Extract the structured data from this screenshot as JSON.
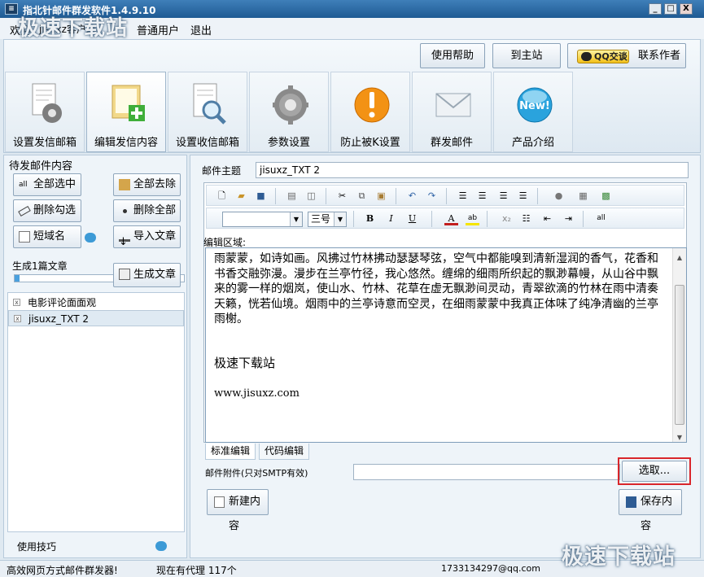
{
  "window": {
    "title": "指北针邮件群发软件1.4.9.10",
    "min_label": "_",
    "max_label": "□",
    "close_label": "X"
  },
  "menu": {
    "welcome": "欢迎",
    "user_text": "jisuxz客户端",
    "role": "普通用户",
    "logout": "退出"
  },
  "watermark_top": "极速下载站",
  "watermark_bottom": "极速下载站",
  "top_buttons": {
    "help": "使用帮助",
    "home": "到主站",
    "qq_badge": "QQ交谈",
    "contact": "联系作者"
  },
  "toolbar": [
    {
      "label": "设置发信邮箱",
      "icon": "gear-document-icon"
    },
    {
      "label": "编辑发信内容",
      "icon": "folder-add-icon"
    },
    {
      "label": "设置收信邮箱",
      "icon": "magnifier-document-icon"
    },
    {
      "label": "参数设置",
      "icon": "gear-icon"
    },
    {
      "label": "防止被K设置",
      "icon": "warning-icon"
    },
    {
      "label": "群发邮件",
      "icon": "envelope-icon"
    },
    {
      "label": "产品介绍",
      "icon": "new-badge-icon"
    }
  ],
  "left": {
    "title": "待发邮件内容",
    "select_all": "全部选中",
    "remove_all": "全部去除",
    "delete_checked": "删除勾选",
    "delete_all": "删除全部",
    "short_domain": "短域名",
    "import_article": "导入文章",
    "generated_text": "生成1篇文章",
    "generate_button": "生成文章",
    "progress": 0.03,
    "items": [
      {
        "label": "电影评论面面观",
        "checked": "x"
      },
      {
        "label": "jisuxz_TXT 2",
        "checked": "x"
      }
    ],
    "tips": "使用技巧"
  },
  "editor": {
    "subject_label": "邮件主题",
    "subject_value": "jisuxz_TXT 2",
    "font_size_value": "三号",
    "font_name_value": "",
    "area_label": "编辑区域:",
    "body_paragraph": "雨蒙蒙，如诗如画。风拂过竹林拂动瑟瑟琴弦，空气中都能嗅到清新湿润的香气，花香和书香交融弥漫。漫步在兰亭竹径，我心悠然。缠绵的细雨所织起的飘渺幕幔，从山谷中飘来的雾一样的烟岚，使山水、竹林、花草在虚无飘渺间灵动，青翠欲滴的竹林在雨中清奏天籁，恍若仙境。烟雨中的兰亭诗意而空灵，在细雨蒙蒙中我真正体味了纯净清幽的兰亭雨榭。",
    "body_line2": "极速下载站",
    "body_line3": "www.jisuxz.com",
    "tab_standard": "标准编辑",
    "tab_code": "代码编辑",
    "attachment_label": "邮件附件(只对SMTP有效)",
    "attachment_value": "",
    "browse_button": "选取...",
    "new_button": "新建内容",
    "save_button": "保存内容"
  },
  "status": {
    "left": "高效网页方式邮件群发器!",
    "proxy": "现在有代理 117个",
    "email": "1733134297@qq.com"
  }
}
